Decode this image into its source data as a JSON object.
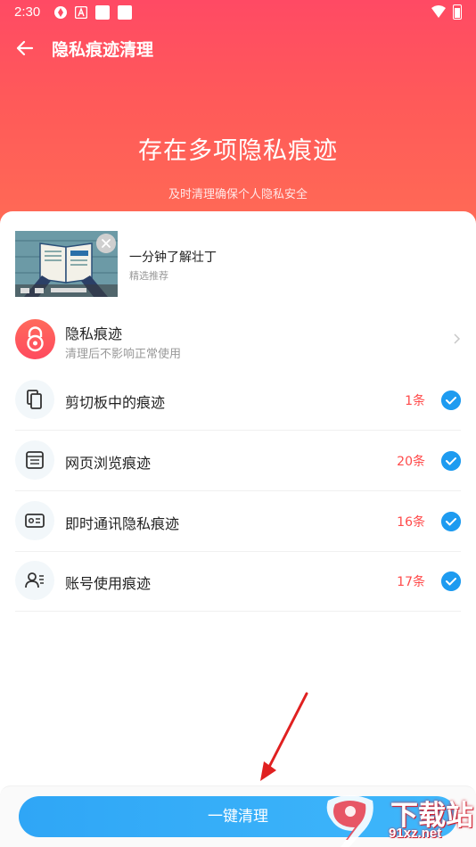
{
  "status_bar": {
    "time": "2:30"
  },
  "header": {
    "title": "隐私痕迹清理"
  },
  "hero": {
    "title": "存在多项隐私痕迹",
    "subtitle": "及时清理确保个人隐私安全"
  },
  "promo": {
    "title": "一分钟了解壮丁",
    "subtitle": "精选推荐"
  },
  "category": {
    "title": "隐私痕迹",
    "subtitle": "清理后不影响正常使用"
  },
  "items": [
    {
      "label": "剪切板中的痕迹",
      "count": "1条",
      "checked": true,
      "icon": "clipboard-icon"
    },
    {
      "label": "网页浏览痕迹",
      "count": "20条",
      "checked": true,
      "icon": "browser-icon"
    },
    {
      "label": "即时通讯隐私痕迹",
      "count": "16条",
      "checked": true,
      "icon": "id-card-icon"
    },
    {
      "label": "账号使用痕迹",
      "count": "17条",
      "checked": true,
      "icon": "user-list-icon"
    }
  ],
  "action": {
    "clean_label": "一键清理"
  },
  "watermark": {
    "name": "下载站",
    "site": "91xz.net"
  },
  "colors": {
    "accent_red": "#ff4a5e",
    "accent_blue": "#1e9bf0",
    "count_red": "#ff4a4a"
  }
}
